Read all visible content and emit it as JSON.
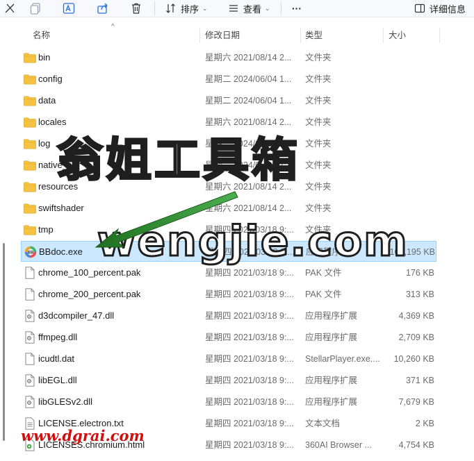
{
  "toolbar": {
    "sort_label": "排序",
    "view_label": "查看",
    "more_label": "···",
    "details_label": "详细信息"
  },
  "columns": {
    "name": "名称",
    "modified": "修改日期",
    "type": "类型",
    "size": "大小"
  },
  "files": [
    {
      "name": "bin",
      "date": "星期六 2021/08/14 2...",
      "type": "文件夹",
      "size": "",
      "icon": "folder-icon"
    },
    {
      "name": "config",
      "date": "星期二 2024/06/04 1...",
      "type": "文件夹",
      "size": "",
      "icon": "folder-icon"
    },
    {
      "name": "data",
      "date": "星期二 2024/06/04 1...",
      "type": "文件夹",
      "size": "",
      "icon": "folder-icon"
    },
    {
      "name": "locales",
      "date": "星期六 2021/08/14 2...",
      "type": "文件夹",
      "size": "",
      "icon": "folder-icon"
    },
    {
      "name": "log",
      "date": "星期二 2024/06/04 1...",
      "type": "文件夹",
      "size": "",
      "icon": "folder-icon"
    },
    {
      "name": "native_lib",
      "date": "星期二 2024/06/04 1...",
      "type": "文件夹",
      "size": "",
      "icon": "folder-icon"
    },
    {
      "name": "resources",
      "date": "星期六 2021/08/14 2...",
      "type": "文件夹",
      "size": "",
      "icon": "folder-icon"
    },
    {
      "name": "swiftshader",
      "date": "星期六 2021/08/14 2...",
      "type": "文件夹",
      "size": "",
      "icon": "folder-icon"
    },
    {
      "name": "tmp",
      "date": "星期四 2021/03/18 9:...",
      "type": "文件夹",
      "size": "",
      "icon": "folder-icon"
    },
    {
      "name": "BBdoc.exe",
      "date": "星期四 2021/03/18 9:...",
      "type": "应用程序",
      "size": "108,195 KB",
      "icon": "bbdoc-app-icon",
      "selected": true
    },
    {
      "name": "chrome_100_percent.pak",
      "date": "星期四 2021/03/18 9:...",
      "type": "PAK 文件",
      "size": "176 KB",
      "icon": "file-icon"
    },
    {
      "name": "chrome_200_percent.pak",
      "date": "星期四 2021/03/18 9:...",
      "type": "PAK 文件",
      "size": "313 KB",
      "icon": "file-icon"
    },
    {
      "name": "d3dcompiler_47.dll",
      "date": "星期四 2021/03/18 9:...",
      "type": "应用程序扩展",
      "size": "4,369 KB",
      "icon": "dll-icon"
    },
    {
      "name": "ffmpeg.dll",
      "date": "星期四 2021/03/18 9:...",
      "type": "应用程序扩展",
      "size": "2,709 KB",
      "icon": "dll-icon"
    },
    {
      "name": "icudtl.dat",
      "date": "星期四 2021/03/18 9:...",
      "type": "StellarPlayer.exe....",
      "size": "10,260 KB",
      "icon": "file-icon"
    },
    {
      "name": "libEGL.dll",
      "date": "星期四 2021/03/18 9:...",
      "type": "应用程序扩展",
      "size": "371 KB",
      "icon": "dll-icon"
    },
    {
      "name": "libGLESv2.dll",
      "date": "星期四 2021/03/18 9:...",
      "type": "应用程序扩展",
      "size": "7,679 KB",
      "icon": "dll-icon"
    },
    {
      "name": "LICENSE.electron.txt",
      "date": "星期四 2021/03/18 9:...",
      "type": "文本文档",
      "size": "2 KB",
      "icon": "text-file-icon"
    },
    {
      "name": "LICENSES.chromium.html",
      "date": "星期四 2021/03/18 9:...",
      "type": "360AI Browser ...",
      "size": "4,754 KB",
      "icon": "html-file-icon"
    }
  ],
  "watermark": {
    "chinese_text": "翁姐工具箱",
    "english_text": "wengjie.com",
    "url_text": "www.dgrai.com"
  },
  "colors": {
    "selection_bg": "#cce8ff",
    "selection_border": "#99d1ff",
    "folder": "#f5c242",
    "arrow": "#2e8b2e",
    "url_red": "#d01010"
  }
}
